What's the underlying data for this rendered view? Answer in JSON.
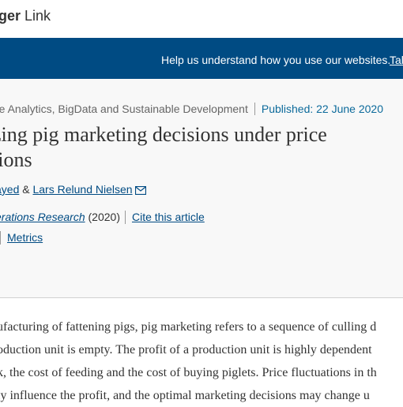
{
  "logo": {
    "part1": "ger",
    "part2": " Link"
  },
  "cookie_banner": {
    "text": "Help us understand how you use our websites.",
    "link": "Tal"
  },
  "article": {
    "section": "re Analytics, BigData and Sustainable Development",
    "published": "Published: 22 June 2020",
    "title_line1": "zing pig marketing decisions under price",
    "title_line2": "tions",
    "author1": "ayed",
    "amp": "&",
    "author2": "Lars Relund Nielsen",
    "journal": "erations Research",
    "year": " (2020)",
    "cite": "Cite this article",
    "metrics": "Metrics"
  },
  "abstract_lines": [
    "ufacturing of fattening pigs, pig marketing refers to a sequence of culling d",
    "oduction unit is empty. The profit of a production unit is highly dependent",
    "k, the cost of feeding and the cost of buying piglets. Price fluctuations in th",
    "ly influence the profit, and the optimal marketing decisions may change u"
  ],
  "colors": {
    "cookie_bg": "#004b83",
    "link": "#004b83",
    "published": "#0c6a9b"
  },
  "icons": {
    "mail": "mail-icon"
  }
}
